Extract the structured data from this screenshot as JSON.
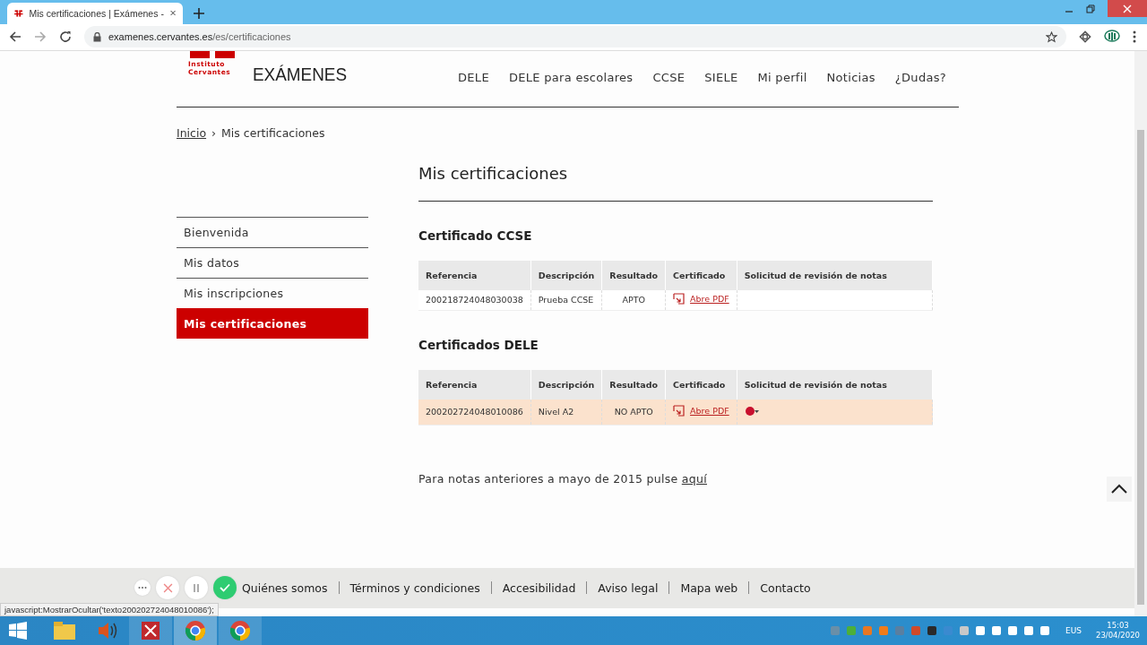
{
  "browser": {
    "tab_title": "Mis certificaciones | Exámenes -",
    "url_host": "examenes.cervantes.es",
    "url_path": "/es/certificaciones"
  },
  "site": {
    "logo_lines": [
      "Instituto",
      "Cervantes"
    ],
    "brand": "EXÁMENES",
    "nav": [
      "DELE",
      "DELE para escolares",
      "CCSE",
      "SIELE",
      "Mi perfil",
      "Noticias",
      "¿Dudas?"
    ]
  },
  "breadcrumb_separator": "›",
  "breadcrumb": [
    {
      "label": "Inicio",
      "link": true
    },
    {
      "label": "Mis certificaciones",
      "link": false
    }
  ],
  "sidebar": {
    "items": [
      {
        "label": "Bienvenida",
        "selected": false
      },
      {
        "label": "Mis datos",
        "selected": false
      },
      {
        "label": "Mis inscripciones",
        "selected": false
      },
      {
        "label": "Mis certificaciones",
        "selected": true
      }
    ]
  },
  "heading": "Mis certificaciones",
  "sections": [
    {
      "title": "Certificado CCSE",
      "columns": [
        "Referencia",
        "Descripción",
        "Resultado",
        "Certificado",
        "Solicitud de revisión de notas"
      ],
      "rows": [
        {
          "reference": "200218724048030038",
          "description": "Prueba CCSE",
          "result": "APTO",
          "certificate": "Abre PDF",
          "highlighted": false,
          "revision_toggle": false
        }
      ]
    },
    {
      "title": "Certificados DELE",
      "columns": [
        "Referencia",
        "Descripción",
        "Resultado",
        "Certificado",
        "Solicitud de revisión de notas"
      ],
      "rows": [
        {
          "reference": "200202724048010086",
          "description": "Nivel A2",
          "result": "NO APTO",
          "certificate": "Abre PDF",
          "highlighted": true,
          "revision_toggle": true
        }
      ]
    }
  ],
  "note": {
    "text": "Para notas anteriores a mayo de 2015 pulse",
    "link": "aquí"
  },
  "footer": {
    "links": [
      "Quiénes somos",
      "Términos y condiciones",
      "Accesibilidad",
      "Aviso legal",
      "Mapa web",
      "Contacto"
    ]
  },
  "status_url": "javascript:MostrarOcultar('texto200202724048010086');",
  "taskbar": {
    "language": "EUS",
    "time": "15:03",
    "date": "23/04/2020"
  }
}
